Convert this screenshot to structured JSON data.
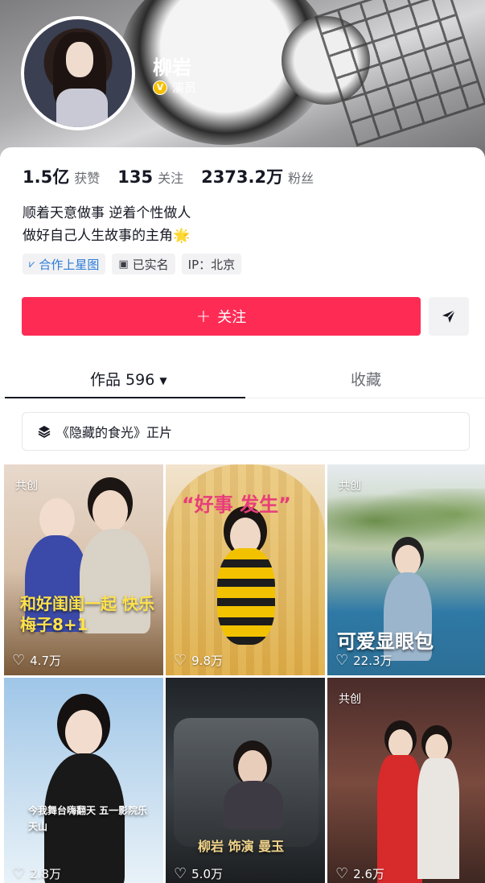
{
  "profile": {
    "name": "柳岩",
    "verify_badge": "V",
    "verify_label": "演员"
  },
  "stats": [
    {
      "value": "1.5亿",
      "label": "获赞"
    },
    {
      "value": "135",
      "label": "关注"
    },
    {
      "value": "2373.2万",
      "label": "粉丝"
    }
  ],
  "bio": {
    "line1": "顺着天意做事 逆着个性做人",
    "line2": "做好自己人生故事的主角",
    "emoji": "🌟"
  },
  "tags": [
    {
      "icon": "xingtu-icon",
      "label": "合作上星图"
    },
    {
      "icon": "id-card-icon",
      "label": "已实名"
    },
    {
      "icon": "",
      "label": "IP：北京"
    }
  ],
  "actions": {
    "follow_label": "关注",
    "follow_plus": "+",
    "share_icon": "send-arrow-icon"
  },
  "tabs": {
    "works_label": "作品 596",
    "favorites_label": "收藏"
  },
  "collection": {
    "label": "《隐藏的食光》正片",
    "icon": "layers-icon"
  },
  "videos": [
    {
      "badge": "共创",
      "likes": "4.7万",
      "caption": "和好闺闺一起 快乐梅子8+1"
    },
    {
      "badge": "",
      "likes": "9.8万",
      "caption": "“好事 发生”"
    },
    {
      "badge": "共创",
      "likes": "22.3万",
      "caption": "可爱显眼包"
    },
    {
      "badge": "",
      "likes": "2.8万",
      "caption": "今我舞台嗨翻天 五一影院乐天山"
    },
    {
      "badge": "",
      "likes": "5.0万",
      "caption": "柳岩 饰演 曼玉"
    },
    {
      "badge": "共创",
      "likes": "2.6万",
      "caption": ""
    }
  ],
  "colors": {
    "accent": "#fe2c55",
    "verify": "#f5c000",
    "link_blue": "#2a7bd6"
  }
}
